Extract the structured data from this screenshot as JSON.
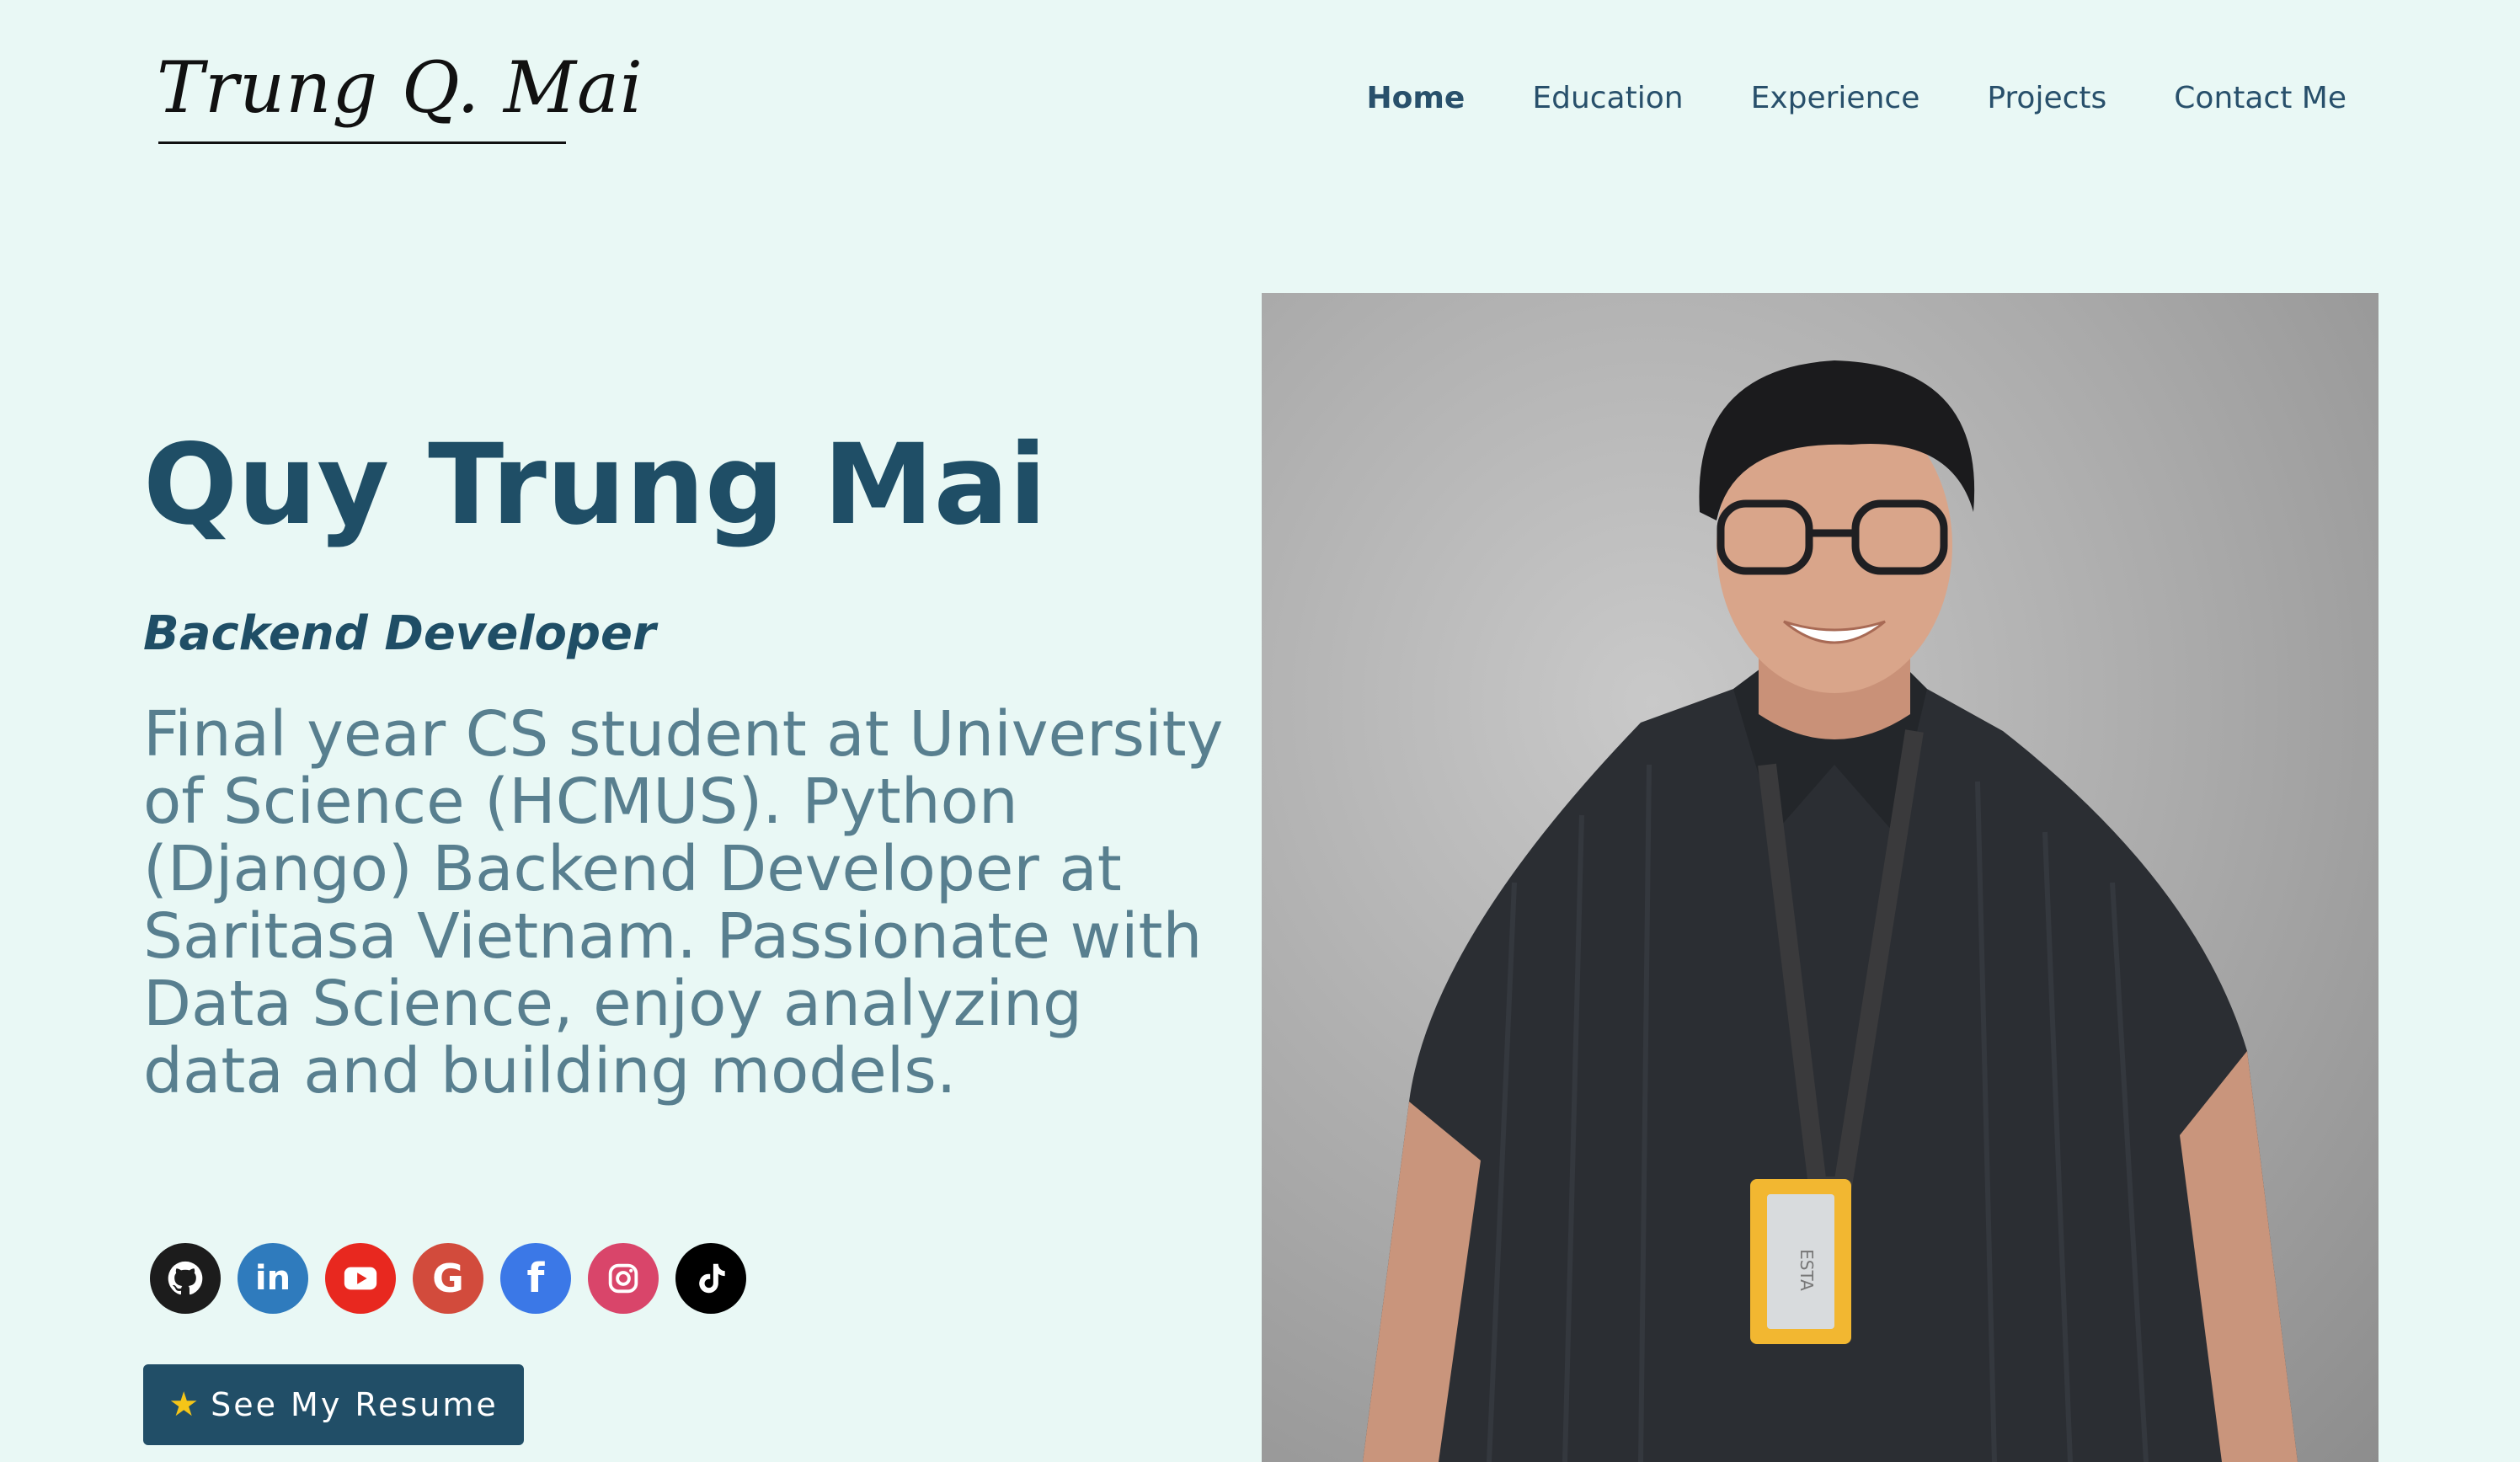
{
  "header": {
    "logo": "Trung Q. Mai",
    "nav": [
      {
        "label": "Home",
        "active": true
      },
      {
        "label": "Education",
        "active": false
      },
      {
        "label": "Experience",
        "active": false
      },
      {
        "label": "Projects",
        "active": false
      },
      {
        "label": "Contact Me",
        "active": false
      }
    ]
  },
  "hero": {
    "name": "Quy Trung Mai",
    "role": "Backend Developer",
    "bio": "Final year CS student at University of Science (HCMUS). Python (Django) Backend Developer at Saritasa Vietnam. Passionate with Data Science, enjoy analyzing data and building models.",
    "resume_button": "See My Resume"
  },
  "socials": [
    {
      "name": "github-icon",
      "color": "#1c1c1c"
    },
    {
      "name": "linkedin-icon",
      "color": "#2f7bbd"
    },
    {
      "name": "youtube-icon",
      "color": "#e8281f"
    },
    {
      "name": "google-icon",
      "color": "#d24b3c"
    },
    {
      "name": "facebook-icon",
      "color": "#3b78e7"
    },
    {
      "name": "instagram-icon",
      "color": "#d9456a"
    },
    {
      "name": "tiktok-icon",
      "color": "#000000"
    }
  ],
  "colors": {
    "background": "#e9f8f5",
    "primary": "#1f4e66",
    "bio_text": "#587f8f"
  },
  "photo": {
    "badge_text": "ESTA"
  }
}
